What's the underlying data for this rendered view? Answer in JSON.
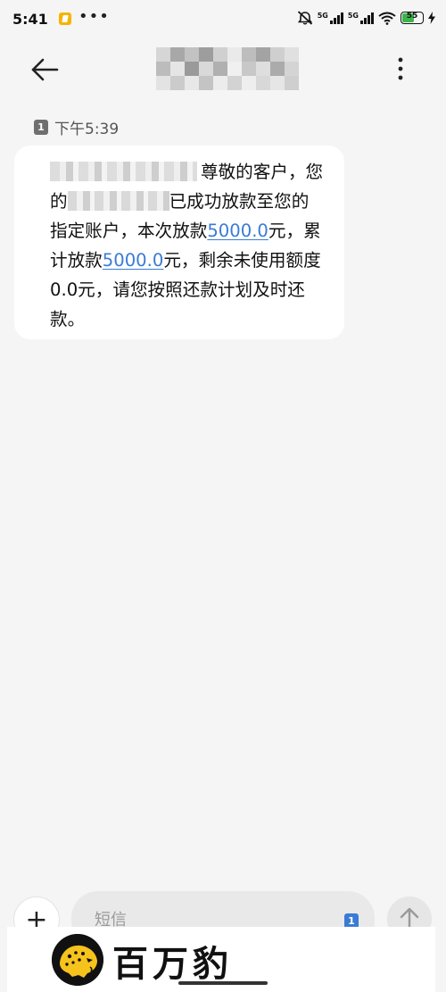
{
  "status_bar": {
    "time": "5:41",
    "network_1": "5G",
    "network_2": "5G",
    "battery": "55",
    "icons": [
      "app-notification-icon",
      "more-dots-icon",
      "mute-icon",
      "signal-icon",
      "wifi-icon",
      "battery-icon",
      "charging-icon"
    ]
  },
  "header": {
    "icons": [
      "back-arrow-icon",
      "more-vertical-icon"
    ]
  },
  "thread": {
    "sim_badge": "1",
    "timestamp": "下午5:39"
  },
  "message": {
    "part1": "尊敬的客户，您的",
    "part2": "已成功放款至您的指定账户，本次放款",
    "amount_1": "5000.0",
    "part3": "元，累计放款",
    "amount_2": "5000.0",
    "part4": "元，剩余未使用额度0.0元，请您按照还款计划及时还款。",
    "link_color": "#3a7bd5"
  },
  "composer": {
    "placeholder": "短信",
    "sim_badge": "1",
    "icons": [
      "add-icon",
      "send-arrow-icon"
    ]
  },
  "watermark": {
    "brand": "百万豹",
    "icons": [
      "leopard-logo-icon"
    ]
  }
}
